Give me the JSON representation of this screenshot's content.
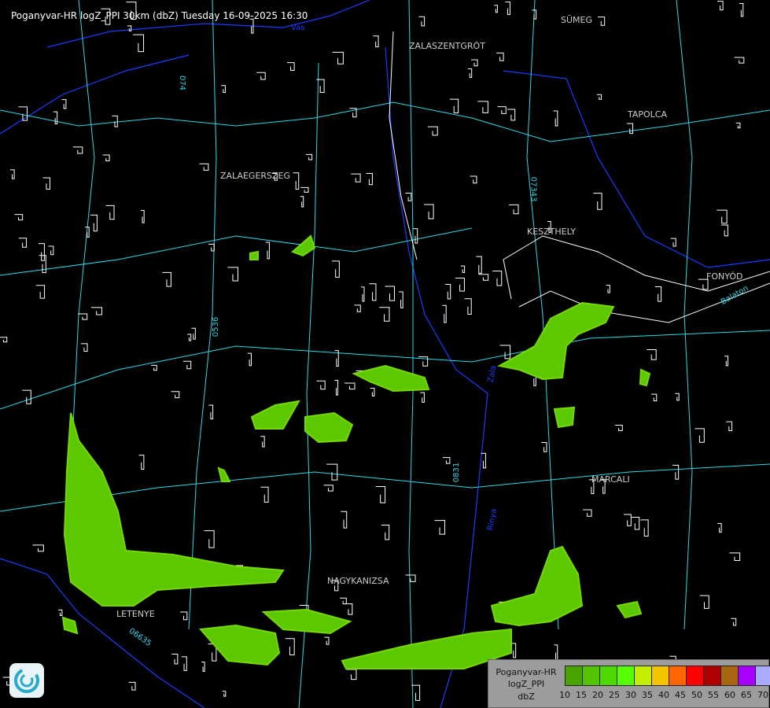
{
  "title": "Poganyvar-HR logZ_PPI 30km (dbZ) Tuesday 16-09-2025 16:30",
  "towns": [
    "SÜMEG",
    "ZALASZENTGRÓT",
    "TAPOLCA",
    "ZALAEGERSZEG",
    "KESZTHELY",
    "FONYÓD",
    "MARCALI",
    "NAGYKANIZSA",
    "LETENYE"
  ],
  "road_labels": [
    "074",
    "07343",
    "0536",
    "0831",
    "Zala",
    "Rinya",
    "Balaton",
    "06635",
    "Vas"
  ],
  "legend": {
    "lines": [
      "Poganyvar-HR",
      "logZ_PPI",
      "dbZ"
    ],
    "ticks": [
      "10",
      "15",
      "20",
      "25",
      "30",
      "35",
      "40",
      "45",
      "50",
      "55",
      "60",
      "65",
      "70"
    ],
    "colors": [
      "#4aa400",
      "#52c400",
      "#4cd800",
      "#58ff00",
      "#c4ee00",
      "#f4c400",
      "#ff6600",
      "#ff0000",
      "#ae0000",
      "#a86610",
      "#a800ff",
      "#aaaaff"
    ]
  },
  "colors": {
    "rivers": "#1a3cff",
    "roads": "#2fd8e8",
    "settlements": "#ffffff",
    "border": "#f0c080",
    "echo_weak": "#5cc800",
    "echo_mid": "#76d800"
  },
  "icons": [
    "radar-logo-icon"
  ]
}
